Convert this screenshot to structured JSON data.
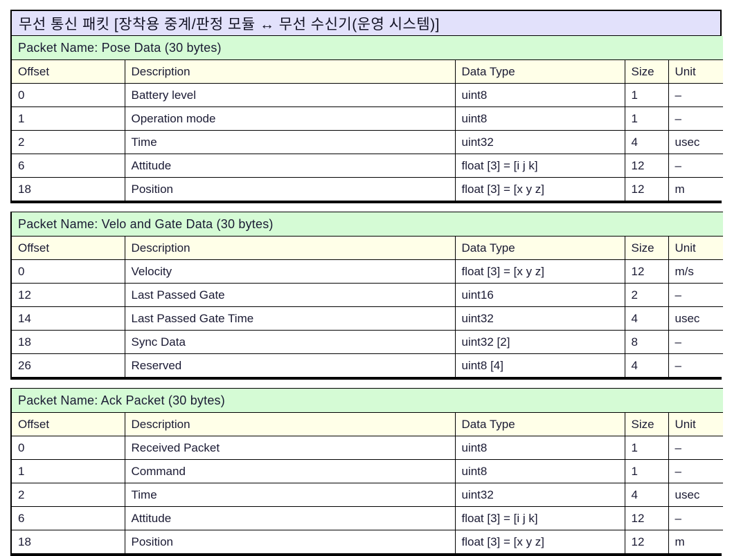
{
  "document": {
    "title": "무선 통신 패킷 [장착용 중계/판정 모듈 ↔ 무선 수신기(운영 시스템)]"
  },
  "columns": {
    "offset": "Offset",
    "description": "Description",
    "data_type": "Data Type",
    "size": "Size",
    "unit": "Unit"
  },
  "colors": {
    "title_band": "#E2E1FB",
    "packet_band": "#D5FBD5",
    "header_band": "#FFFFE8",
    "row_bg": "#FFFFFF",
    "border": "#000000"
  },
  "packets": [
    {
      "name": "Packet Name: Pose Data (30 bytes)",
      "rows": [
        {
          "offset": "0",
          "description": "Battery level",
          "data_type": "uint8",
          "size": "1",
          "unit": "–"
        },
        {
          "offset": "1",
          "description": "Operation mode",
          "data_type": "uint8",
          "size": "1",
          "unit": "–"
        },
        {
          "offset": "2",
          "description": "Time",
          "data_type": "uint32",
          "size": "4",
          "unit": "usec"
        },
        {
          "offset": "6",
          "description": "Attitude",
          "data_type": "float [3] = [i j k]",
          "size": "12",
          "unit": "–"
        },
        {
          "offset": "18",
          "description": "Position",
          "data_type": "float [3] = [x y z]",
          "size": "12",
          "unit": "m"
        }
      ]
    },
    {
      "name": "Packet Name: Velo and Gate Data (30 bytes)",
      "rows": [
        {
          "offset": "0",
          "description": "Velocity",
          "data_type": "float [3] = [x y z]",
          "size": "12",
          "unit": "m/s"
        },
        {
          "offset": "12",
          "description": "Last Passed Gate",
          "data_type": "uint16",
          "size": "2",
          "unit": "–"
        },
        {
          "offset": "14",
          "description": "Last Passed Gate Time",
          "data_type": "uint32",
          "size": "4",
          "unit": "usec"
        },
        {
          "offset": "18",
          "description": "Sync Data",
          "data_type": "uint32 [2]",
          "size": "8",
          "unit": "–"
        },
        {
          "offset": "26",
          "description": "Reserved",
          "data_type": "uint8 [4]",
          "size": "4",
          "unit": "–"
        }
      ]
    },
    {
      "name": "Packet Name: Ack Packet (30 bytes)",
      "rows": [
        {
          "offset": "0",
          "description": "Received Packet",
          "data_type": "uint8",
          "size": "1",
          "unit": "–"
        },
        {
          "offset": "1",
          "description": "Command",
          "data_type": "uint8",
          "size": "1",
          "unit": "–"
        },
        {
          "offset": "2",
          "description": "Time",
          "data_type": "uint32",
          "size": "4",
          "unit": "usec"
        },
        {
          "offset": "6",
          "description": "Attitude",
          "data_type": "float [3] = [i j k]",
          "size": "12",
          "unit": "–"
        },
        {
          "offset": "18",
          "description": "Position",
          "data_type": "float [3] = [x y z]",
          "size": "12",
          "unit": "m"
        }
      ]
    }
  ]
}
